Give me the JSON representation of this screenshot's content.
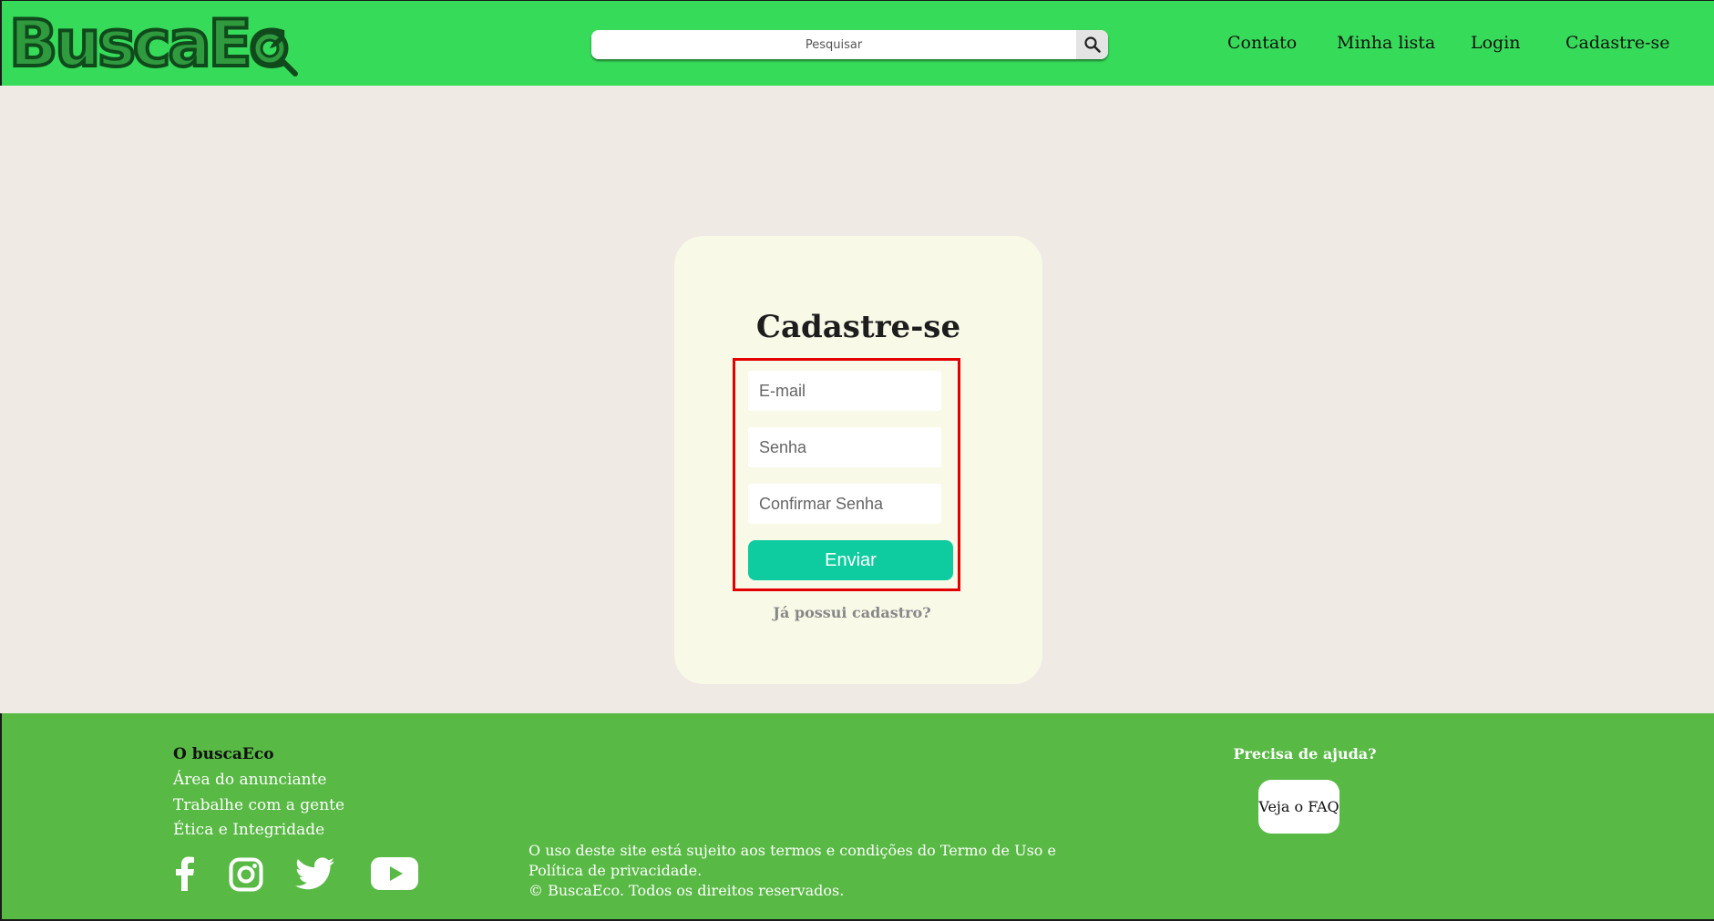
{
  "header": {
    "logo_text": "BuscaEc",
    "search": {
      "placeholder": "Pesquisar",
      "icon": "search-icon"
    },
    "nav": [
      "Contato",
      "Minha lista",
      "Login",
      "Cadastre-se"
    ]
  },
  "signup": {
    "title": "Cadastre-se",
    "email_placeholder": "E-mail",
    "password_placeholder": "Senha",
    "confirm_placeholder": "Confirmar Senha",
    "submit_label": "Enviar",
    "login_link": "Já possui cadastro?"
  },
  "footer": {
    "about_heading": "O buscaEco",
    "links": [
      "Área do anunciante",
      "Trabalhe com a gente",
      "Ética e Integridade"
    ],
    "social": [
      "facebook-icon",
      "instagram-icon",
      "twitter-icon",
      "youtube-icon"
    ],
    "legal_line1": "O uso deste site está sujeito aos termos e condições do Termo de Uso e Política de privacidade.",
    "legal_line2": "© BuscaEco. Todos os direitos reservados.",
    "help_heading": "Precisa de ajuda?",
    "faq_button": "Veja o FAQ"
  },
  "colors": {
    "header_bg": "#37db5a",
    "page_bg": "#efeae4",
    "card_bg": "#f9f9e8",
    "submit_bg": "#0ecc9f",
    "footer_bg": "#58b944",
    "highlight_border": "#e20000"
  }
}
